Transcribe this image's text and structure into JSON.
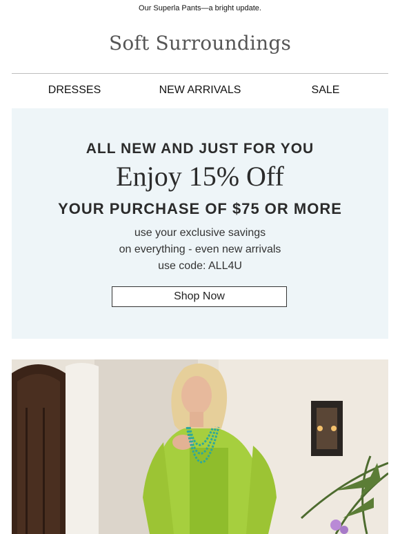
{
  "preheader": {
    "text": "Our Superla Pants—a bright update."
  },
  "brand": {
    "logo_text": "Soft Surroundings"
  },
  "nav": {
    "items": [
      {
        "label": "DRESSES"
      },
      {
        "label": "NEW ARRIVALS"
      },
      {
        "label": "SALE"
      }
    ]
  },
  "promo": {
    "kicker": "ALL NEW AND JUST FOR YOU",
    "headline": "Enjoy 15% Off",
    "subheadline": "YOUR PURCHASE OF $75 OR MORE",
    "lines": [
      "use your exclusive savings",
      "on everything - even new arrivals",
      "use code: ALL4U"
    ],
    "cta_label": "Shop Now"
  },
  "colors": {
    "promo_bg": "#eef5f8",
    "tunic_green": "#a6cf3e",
    "wall": "#e8e2d8"
  }
}
